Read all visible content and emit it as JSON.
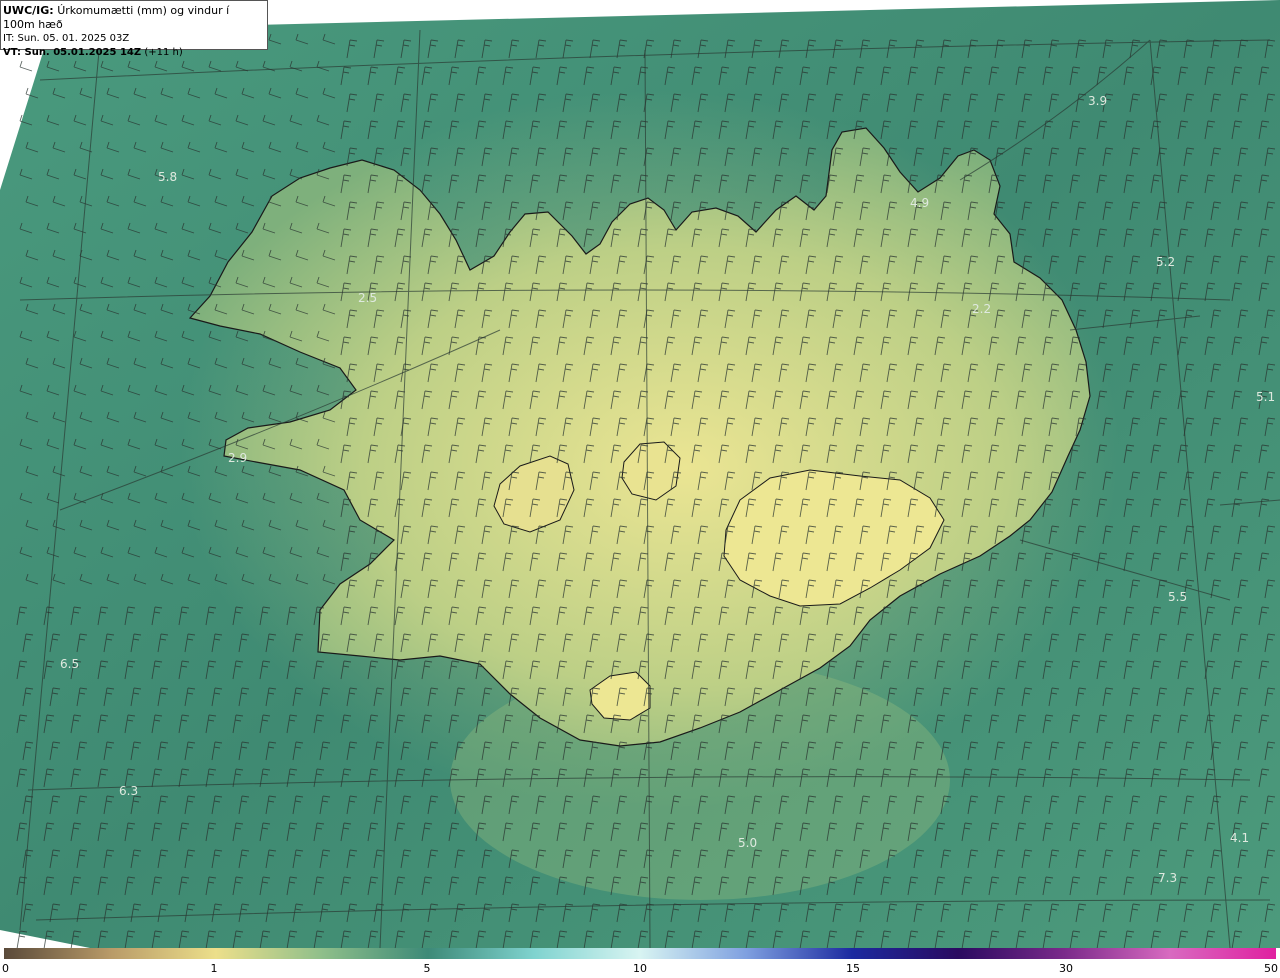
{
  "header": {
    "model_label": "UWC/IG:",
    "title": "Úrkomumætti (mm) og vindur í 100m hæð",
    "issue_time": "IT: Sun. 05. 01. 2025 03Z",
    "valid_label": "VT: Sun. 05.01.2025 14Z",
    "valid_offset": "(+11 h)"
  },
  "map_values": [
    "3.9",
    "5.8",
    "4.9",
    "5.2",
    "2.2",
    "2.5",
    "5.1",
    "2.9",
    "5.5",
    "6.5",
    "6.3",
    "5.0",
    "4.1",
    "7.3"
  ],
  "colorbar": {
    "ticks": [
      "0",
      "1",
      "5",
      "10",
      "15",
      "30",
      "50"
    ],
    "colors": [
      "#5a4a3a",
      "#b89a68",
      "#ecdf8a",
      "#8fbf8a",
      "#3d8a78",
      "#7fd3cf",
      "#d8f4f2",
      "#7fa0e0",
      "#1c2aa0",
      "#2a0a60",
      "#7a2a8a",
      "#d86ac0",
      "#e020a0"
    ]
  },
  "colors": {
    "sea": "#3e8a74",
    "land_high": "#e3e08c",
    "coast": "#1a1a1a"
  }
}
